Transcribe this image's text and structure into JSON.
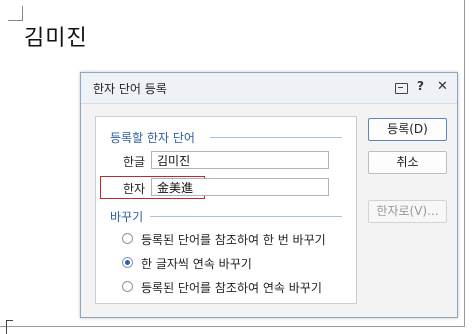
{
  "document": {
    "text": "김미진"
  },
  "dialog": {
    "title": "한자 단어 등록",
    "help_symbol": "?",
    "close_symbol": "✕",
    "register_section": {
      "label": "등록할 한자 단어",
      "hangul_label": "한글",
      "hangul_value": "김미진",
      "hanja_label": "한자",
      "hanja_value": "金美進"
    },
    "replace_section": {
      "label": "바꾸기",
      "options": [
        {
          "label": "등록된 단어를 참조하여 한 번 바꾸기",
          "checked": false
        },
        {
          "label": "한 글자씩 연속 바꾸기",
          "checked": true
        },
        {
          "label": "등록된 단어를 참조하여 연속 바꾸기",
          "checked": false
        }
      ]
    },
    "buttons": {
      "register": "등록(D)",
      "cancel": "취소",
      "to_hanja": "한자로(V)..."
    }
  },
  "colors": {
    "section_label": "#2e5e9e",
    "highlight_border": "#c0282a",
    "accent": "#2a5fb8"
  },
  "icons": {
    "memo": "memo-icon",
    "help": "help-icon",
    "close": "close-icon"
  }
}
